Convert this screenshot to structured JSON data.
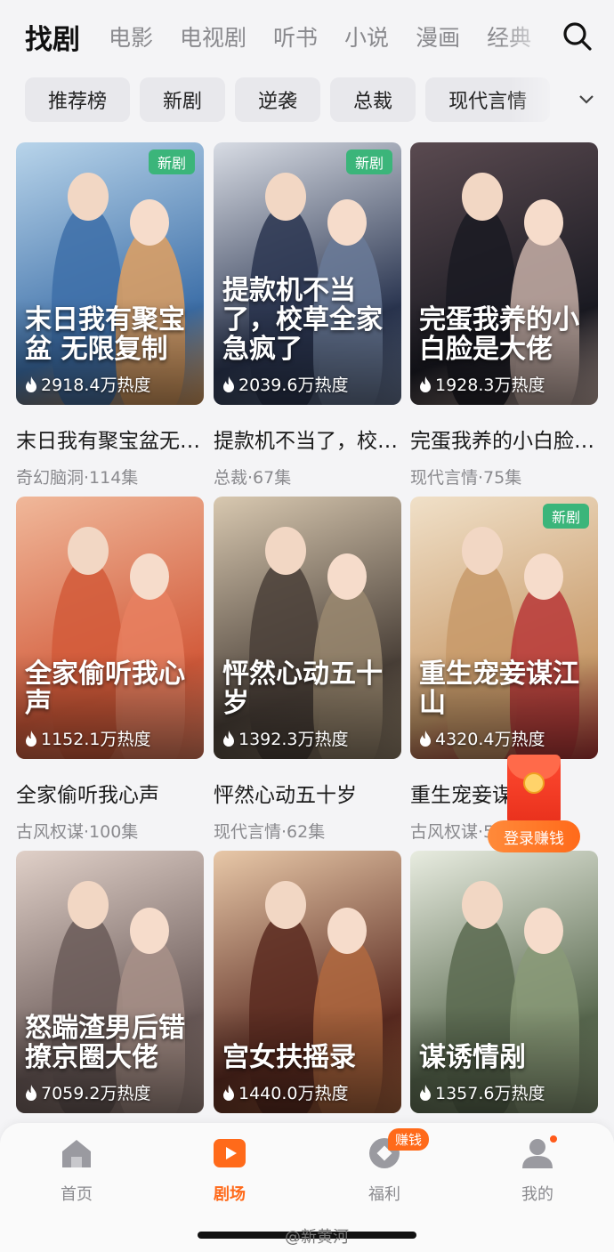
{
  "top_tabs": [
    "找剧",
    "电影",
    "电视剧",
    "听书",
    "小说",
    "漫画",
    "经典"
  ],
  "filter_chips": [
    "推荐榜",
    "新剧",
    "逆袭",
    "总裁",
    "现代言情"
  ],
  "icons": {
    "search": "search-icon",
    "more": "chevron-down-icon",
    "heat": "flame-icon"
  },
  "cards": [
    {
      "poster_title": "末日我有聚宝盆 无限复制",
      "title": "末日我有聚宝盆无限复制",
      "heat": "2918.4万热度",
      "meta": "奇幻脑洞·114集",
      "badge": "新剧",
      "palette": [
        "#3d6fa8",
        "#b8d4ea",
        "#e0a060"
      ]
    },
    {
      "poster_title": "提款机不当了，校草全家急疯了",
      "title": "提款机不当了，校草全家急疯了",
      "heat": "2039.6万热度",
      "meta": "总裁·67集",
      "badge": "新剧",
      "palette": [
        "#2a3550",
        "#d8dce4",
        "#6a7a98"
      ]
    },
    {
      "poster_title": "完蛋我养的小白脸是大佬",
      "title": "完蛋我养的小白脸是大佬",
      "heat": "1928.3万热度",
      "meta": "现代言情·75集",
      "badge": "",
      "palette": [
        "#1a1a22",
        "#5a4a50",
        "#c8b0a8"
      ]
    },
    {
      "poster_title": "全家偷听我心声",
      "title": "全家偷听我心声",
      "heat": "1152.1万热度",
      "meta": "古风权谋·100集",
      "badge": "",
      "palette": [
        "#d25a3a",
        "#f0b89a",
        "#e88060"
      ]
    },
    {
      "poster_title": "怦然心动五十岁",
      "title": "怦然心动五十岁",
      "heat": "1392.3万热度",
      "meta": "现代言情·62集",
      "badge": "",
      "palette": [
        "#4a4038",
        "#d8c8b0",
        "#9a8870"
      ]
    },
    {
      "poster_title": "重生宠妾谋江山",
      "title": "重生宠妾谋江山",
      "heat": "4320.4万热度",
      "meta": "古风权谋·58集",
      "badge": "新剧",
      "palette": [
        "#c89a6a",
        "#f0e0c8",
        "#b83838"
      ]
    },
    {
      "poster_title": "怒踹渣男后错撩京圈大佬",
      "title": "怒踹渣男后错撩京圈大佬",
      "heat": "7059.2万热度",
      "meta": "",
      "badge": "",
      "palette": [
        "#6a5a58",
        "#e0d0c8",
        "#a89088"
      ]
    },
    {
      "poster_title": "宫女扶摇录",
      "title": "宫女扶摇录",
      "heat": "1440.0万热度",
      "meta": "",
      "badge": "",
      "palette": [
        "#5a2a20",
        "#e8c8a8",
        "#b06840"
      ]
    },
    {
      "poster_title": "谋诱情剐",
      "title": "谋诱情剐",
      "heat": "1357.6万热度",
      "meta": "",
      "badge": "",
      "palette": [
        "#5a6a50",
        "#e8ece0",
        "#8a9a78"
      ]
    }
  ],
  "floating": {
    "cta": "登录赚钱"
  },
  "bottom_nav": [
    {
      "label": "首页",
      "icon": "home-icon"
    },
    {
      "label": "剧场",
      "icon": "theater-icon"
    },
    {
      "label": "福利",
      "icon": "gift-icon",
      "badge": "赚钱"
    },
    {
      "label": "我的",
      "icon": "profile-icon"
    }
  ],
  "watermark": "@新黄河",
  "accent_color": "#ff6a1a"
}
